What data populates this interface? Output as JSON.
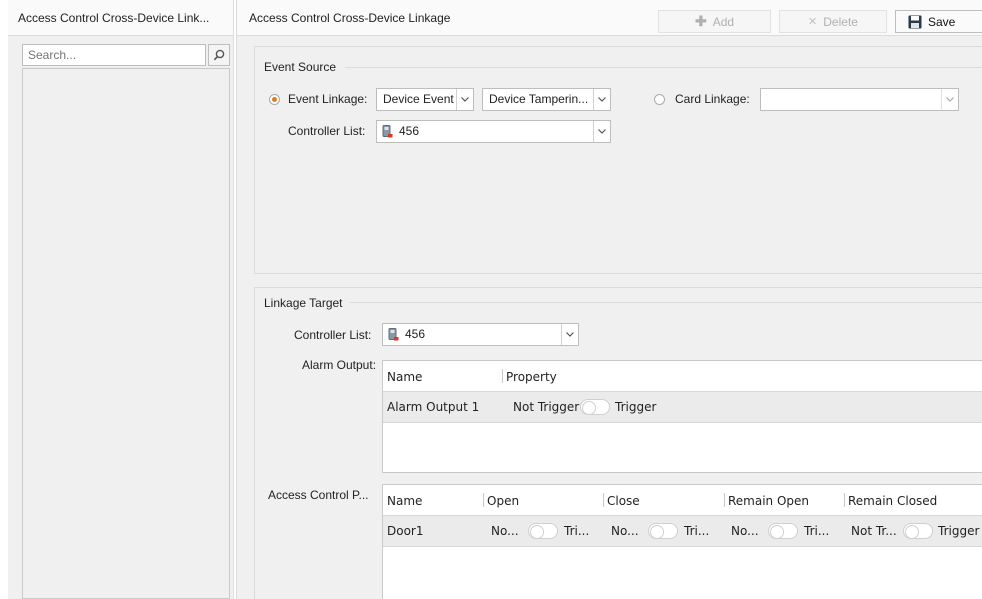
{
  "left_panel": {
    "title": "Access Control Cross-Device Link...",
    "search_placeholder": "Search..."
  },
  "right_panel": {
    "title": "Access Control Cross-Device Linkage",
    "toolbar": {
      "add_label": "Add",
      "delete_label": "Delete",
      "save_label": "Save"
    }
  },
  "event_source": {
    "title": "Event Source",
    "event_linkage_label": "Event Linkage:",
    "event_type_value": "Device Event",
    "event_value": "Device Tamperin...",
    "card_linkage_label": "Card Linkage:",
    "card_linkage_value": "",
    "controller_list_label": "Controller List:",
    "controller_value": "456"
  },
  "linkage_target": {
    "title": "Linkage Target",
    "controller_list_label": "Controller List:",
    "controller_value": "456",
    "alarm_output_label": "Alarm Output:",
    "alarm_table": {
      "headers": [
        "Name",
        "Property"
      ],
      "rows": [
        {
          "name": "Alarm Output 1",
          "off_label": "Not Trigger",
          "on_label": "Trigger"
        }
      ]
    },
    "access_control_label": "Access Control P...",
    "door_table": {
      "headers": [
        "Name",
        "Open",
        "Close",
        "Remain Open",
        "Remain Closed"
      ],
      "rows": [
        {
          "name": "Door1",
          "open": {
            "off": "No...",
            "on": "Tri..."
          },
          "close": {
            "off": "No...",
            "on": "Tri..."
          },
          "remain_open": {
            "off": "No...",
            "on": "Tri..."
          },
          "remain_closed": {
            "off": "Not Tr...",
            "on": "Trigger"
          }
        }
      ]
    }
  },
  "colors": {
    "radio_selected": "#e07b20",
    "panel_bg": "#f0f0f0"
  },
  "icons": [
    "search-icon",
    "plus-icon",
    "close-icon",
    "save-icon",
    "chevron-down-icon",
    "access-controller-icon"
  ]
}
